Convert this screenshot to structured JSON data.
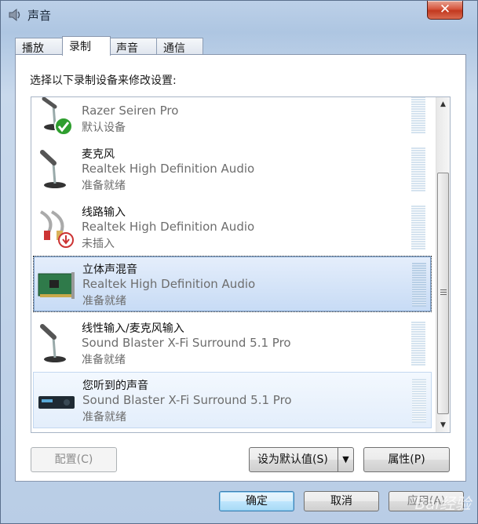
{
  "window": {
    "title": "声音",
    "close_label": "✕"
  },
  "tabs": [
    {
      "label": "播放",
      "active": false
    },
    {
      "label": "录制",
      "active": true
    },
    {
      "label": "声音",
      "active": false
    },
    {
      "label": "通信",
      "active": false
    }
  ],
  "instruction": "选择以下录制设备来修改设置:",
  "devices": [
    {
      "name": "Razer Seiren Pro",
      "driver": "",
      "status": "默认设备",
      "icon": "microphone-icon"
    },
    {
      "name": "麦克风",
      "driver": "Realtek High Definition Audio",
      "status": "准备就绪",
      "icon": "microphone-icon"
    },
    {
      "name": "线路输入",
      "driver": "Realtek High Definition Audio",
      "status": "未插入",
      "icon": "line-in-cable-icon"
    },
    {
      "name": "立体声混音",
      "driver": "Realtek High Definition Audio",
      "status": "准备就绪",
      "icon": "sound-card-icon"
    },
    {
      "name": "线性输入/麦克风输入",
      "driver": "Sound Blaster X-Fi Surround 5.1 Pro",
      "status": "准备就绪",
      "icon": "microphone-icon"
    },
    {
      "name": "您听到的声音",
      "driver": "Sound Blaster X-Fi Surround 5.1 Pro",
      "status": "准备就绪",
      "icon": "sound-blaster-device-icon"
    }
  ],
  "buttons": {
    "configure": "配置(C)",
    "set_default": "设为默认值(S)",
    "set_default_arrow": "▼",
    "properties": "属性(P)",
    "ok": "确定",
    "cancel": "取消",
    "apply": "应用(A)"
  },
  "scrollbar": {
    "up": "▲",
    "down": "▼"
  },
  "watermark": "Bai经验"
}
